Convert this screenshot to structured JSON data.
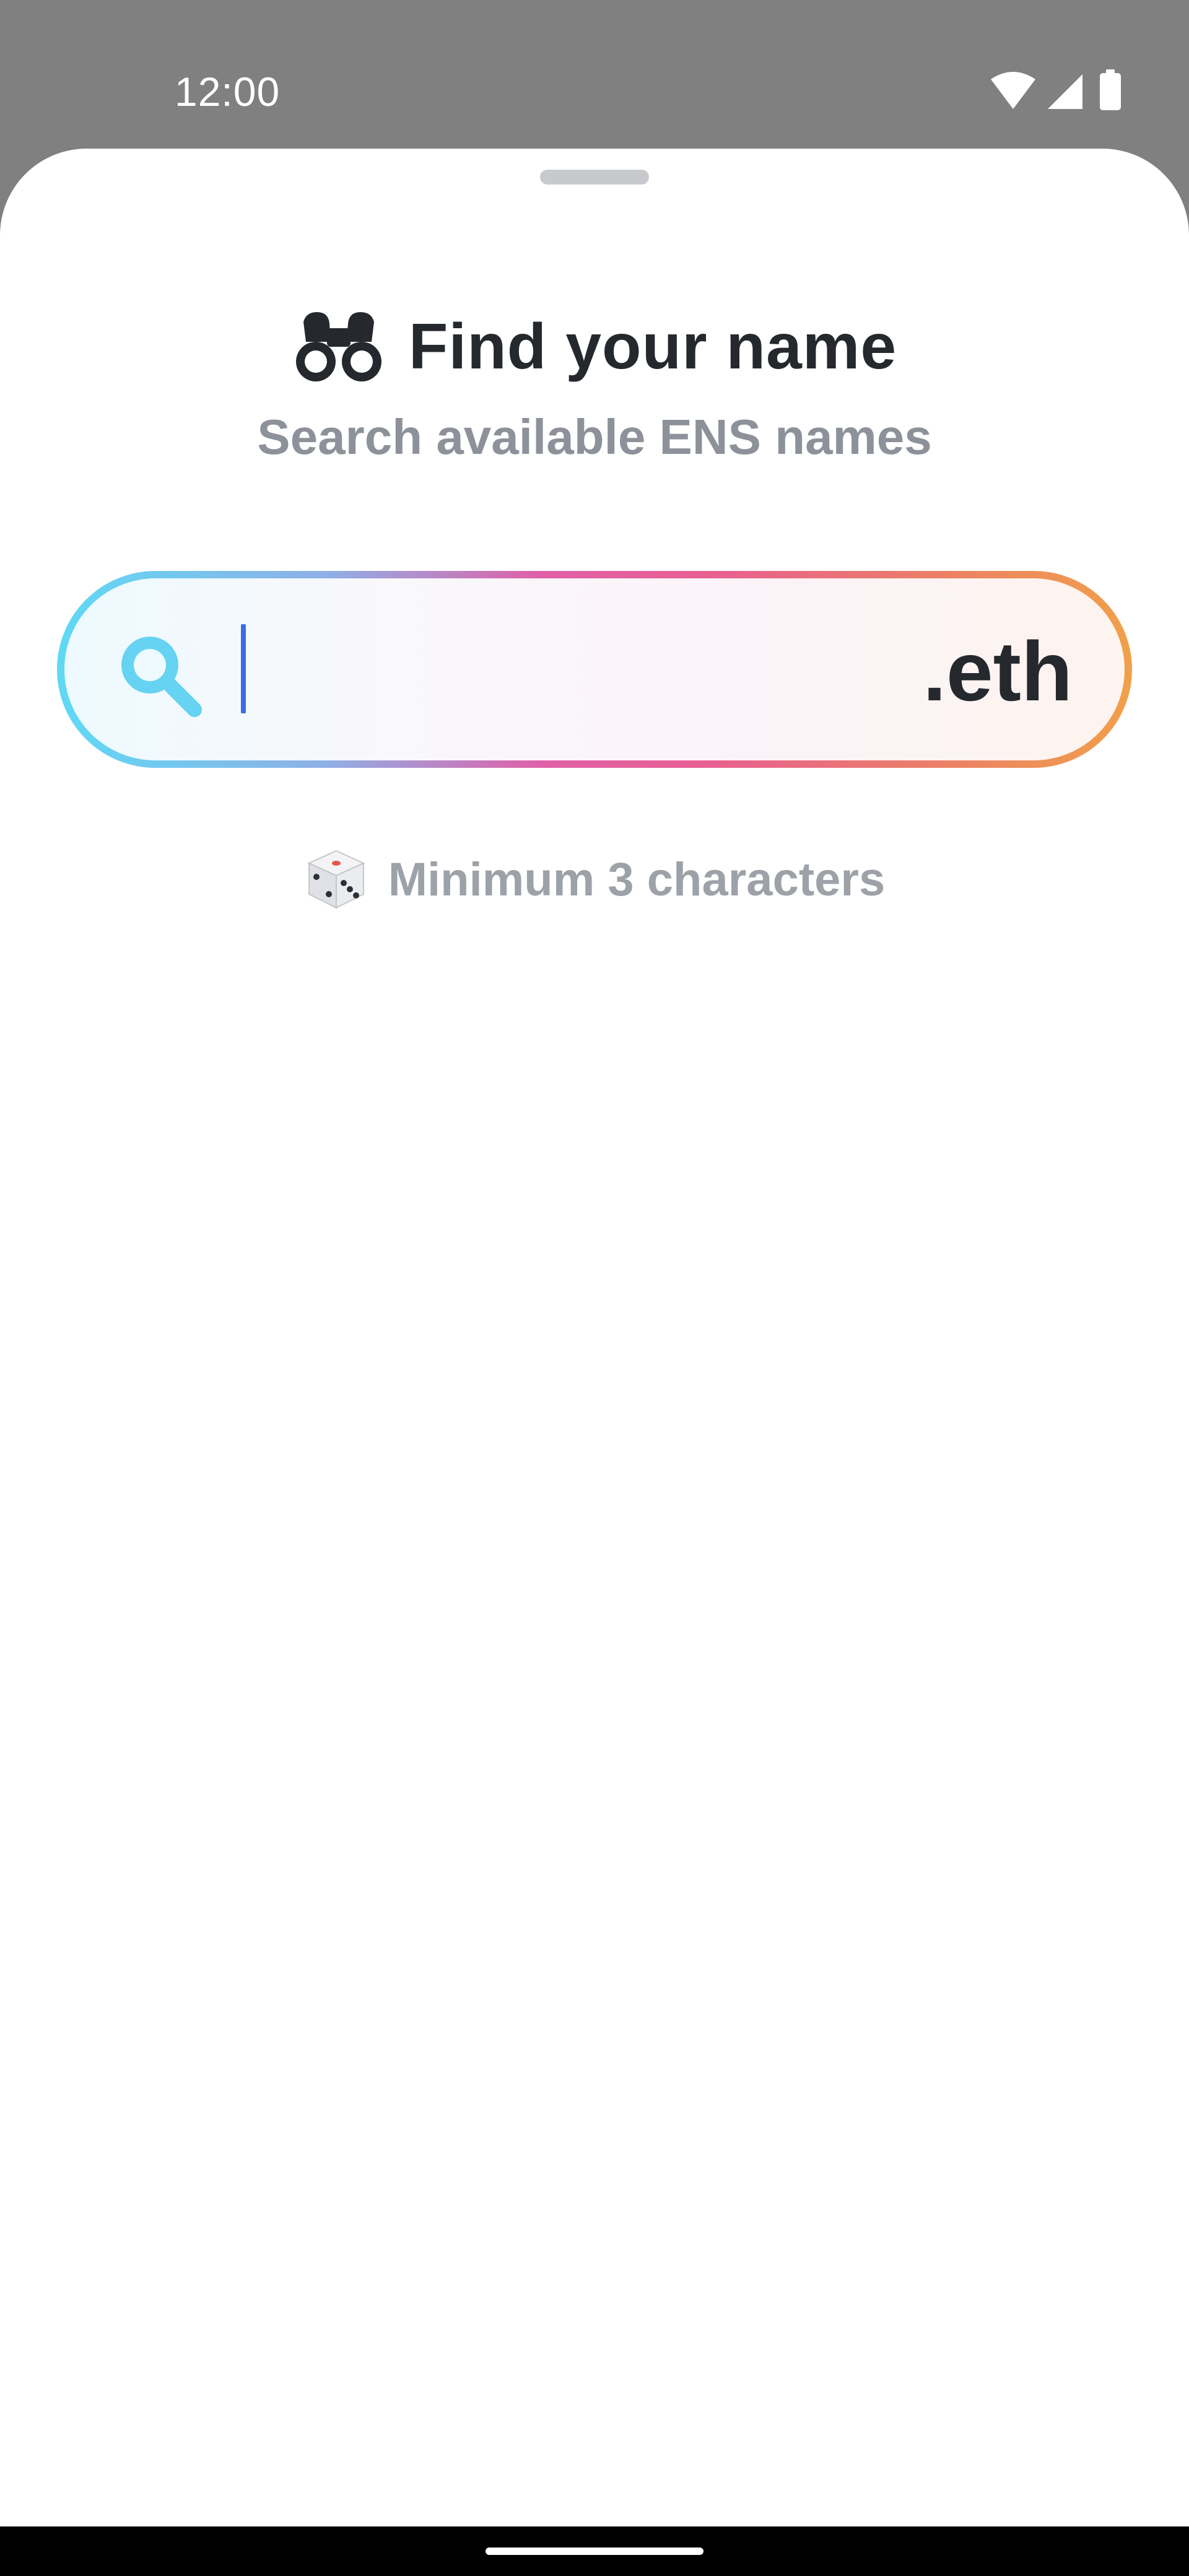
{
  "status_bar": {
    "time": "12:00",
    "icons": [
      "wifi-icon",
      "signal-icon",
      "battery-icon"
    ]
  },
  "sheet": {
    "title": "Find your name",
    "subtitle": "Search available ENS names",
    "title_icon": "binoculars-icon",
    "search": {
      "value": "",
      "placeholder": "",
      "suffix": ".eth",
      "icon": "search-icon"
    },
    "hint": {
      "icon": "dice-icon",
      "text": "Minimum 3 characters"
    }
  },
  "colors": {
    "title": "#25292e",
    "subtitle": "#8d9199",
    "hint": "#9da1a8",
    "gradient_start": "#5fd9f5",
    "gradient_mid": "#e85f92",
    "gradient_end": "#f0a04a",
    "caret": "#3b6fe0"
  }
}
